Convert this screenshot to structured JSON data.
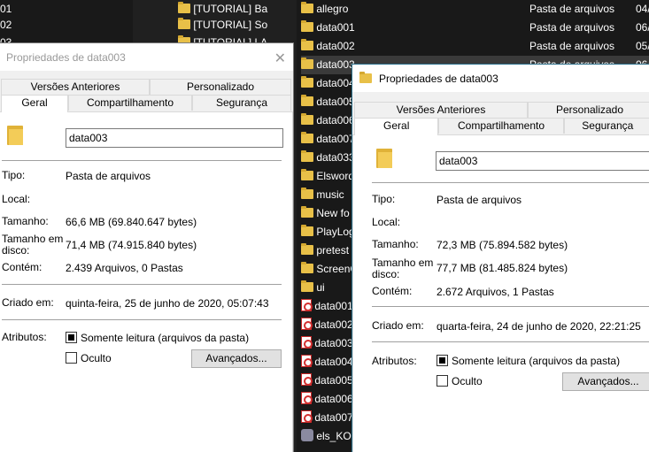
{
  "explorer": {
    "left_col": [
      {
        "name": "01"
      },
      {
        "name": "[TUTORIAL] Ba"
      },
      {
        "name": "02"
      },
      {
        "name": "[TUTORIAL] So"
      },
      {
        "name": "03"
      },
      {
        "name": "[TUTORIAL] LA"
      }
    ],
    "rows": [
      {
        "name": "allegro",
        "type": "Pasta de arquivos",
        "date": "04/"
      },
      {
        "name": "data001",
        "type": "Pasta de arquivos",
        "date": "06/"
      },
      {
        "name": "data002",
        "type": "Pasta de arquivos",
        "date": "05/"
      },
      {
        "name": "data003",
        "type": "Pasta de arquivos",
        "date": "06/"
      },
      {
        "name": "data004"
      },
      {
        "name": "data005"
      },
      {
        "name": "data006"
      },
      {
        "name": "data007"
      },
      {
        "name": "data033"
      },
      {
        "name": "Elsword"
      },
      {
        "name": "music"
      },
      {
        "name": "New fo"
      },
      {
        "name": "PlayLog"
      },
      {
        "name": "pretest"
      },
      {
        "name": "ScreenC"
      },
      {
        "name": "ui"
      },
      {
        "name": "data001"
      },
      {
        "name": "data002"
      },
      {
        "name": "data003"
      },
      {
        "name": "data004"
      },
      {
        "name": "data005"
      },
      {
        "name": "data006"
      },
      {
        "name": "data007"
      },
      {
        "name": "els_KOM"
      }
    ]
  },
  "dialog1": {
    "title": "Propriedades de data003",
    "close": "✕",
    "tabs_top": [
      "Versões Anteriores",
      "Personalizado"
    ],
    "tabs_bottom": [
      "Geral",
      "Compartilhamento",
      "Segurança"
    ],
    "name_value": "data003",
    "labels": {
      "tipo": "Tipo:",
      "local": "Local:",
      "tamanho": "Tamanho:",
      "tamanho_disco_1": "Tamanho em",
      "tamanho_disco_2": "disco:",
      "contem": "Contém:",
      "criado": "Criado em:",
      "atributos": "Atributos:"
    },
    "values": {
      "tipo": "Pasta de arquivos",
      "local": "",
      "tamanho": "66,6 MB (69.840.647 bytes)",
      "tamanho_disco": "71,4 MB (74.915.840 bytes)",
      "contem": "2.439 Arquivos, 0 Pastas",
      "criado": "quinta-feira, 25 de junho de 2020, 05:07:43"
    },
    "attr_readonly": "Somente leitura (arquivos da pasta)",
    "attr_hidden": "Oculto",
    "advanced_button": "Avançados..."
  },
  "dialog2": {
    "title": "Propriedades de data003",
    "tabs_top": [
      "Versões Anteriores",
      "Personalizado"
    ],
    "tabs_bottom": [
      "Geral",
      "Compartilhamento",
      "Segurança"
    ],
    "name_value": "data003",
    "labels": {
      "tipo": "Tipo:",
      "local": "Local:",
      "tamanho": "Tamanho:",
      "tamanho_disco_1": "Tamanho em",
      "tamanho_disco_2": "disco:",
      "contem": "Contém:",
      "criado": "Criado em:",
      "atributos": "Atributos:"
    },
    "values": {
      "tipo": "Pasta de arquivos",
      "local": "",
      "tamanho": "72,3 MB (75.894.582 bytes)",
      "tamanho_disco": "77,7 MB (81.485.824 bytes)",
      "contem": "2.672 Arquivos, 1 Pastas",
      "criado": "quarta-feira, 24 de junho de 2020, 22:21:25"
    },
    "attr_readonly": "Somente leitura (arquivos da pasta)",
    "attr_hidden": "Oculto",
    "advanced_button": "Avançados..."
  }
}
